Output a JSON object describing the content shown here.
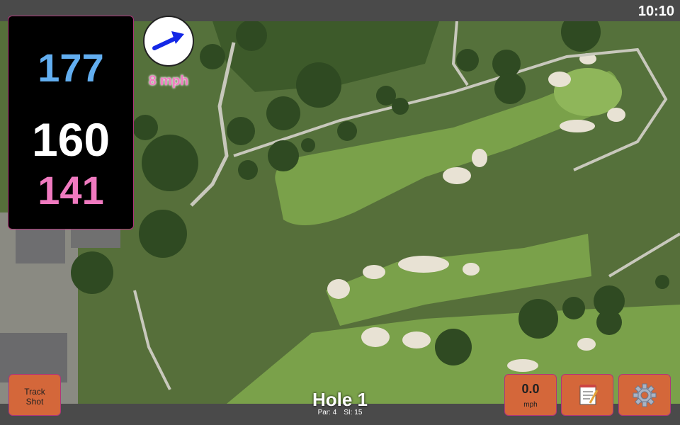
{
  "status": {
    "time": "10:10"
  },
  "yardage": {
    "back": "177",
    "center": "160",
    "front": "141"
  },
  "wind": {
    "speed_label": "8 mph",
    "icon": "wind-arrow-icon",
    "arrow_color": "#1428e6"
  },
  "hole": {
    "title": "Hole 1",
    "par": "Par: 4",
    "stroke_index": "SI: 15"
  },
  "buttons": {
    "track_shot": [
      "Track",
      "Shot"
    ],
    "speed_value": "0.0",
    "speed_unit": "mph",
    "notes_icon": "notepad-icon",
    "settings_icon": "gear-icon"
  },
  "colors": {
    "back_yardage": "#62aef0",
    "center_yardage": "#ffffff",
    "front_yardage": "#f07ac0",
    "button": "#d4673a",
    "accent_border": "#b0357a"
  }
}
